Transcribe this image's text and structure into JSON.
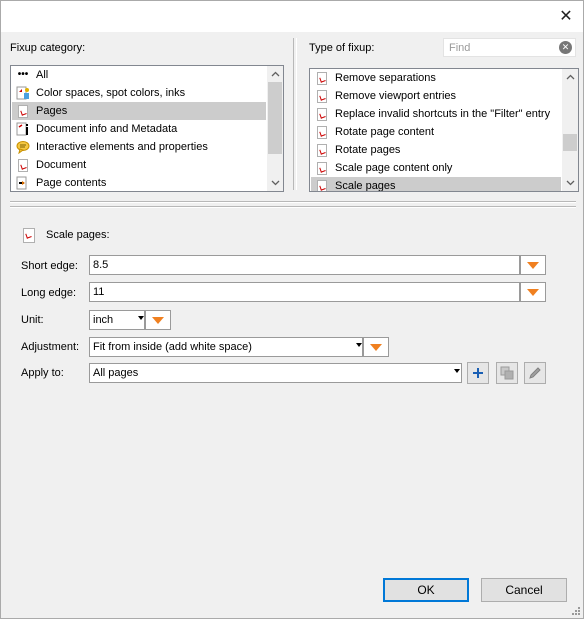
{
  "window": {
    "close_glyph": "✕"
  },
  "fixup_category": {
    "label": "Fixup category:",
    "items": [
      {
        "label": "All",
        "icon": "ellipsis-icon",
        "selected": false
      },
      {
        "label": "Color spaces, spot colors, inks",
        "icon": "color-spaces-icon",
        "selected": false
      },
      {
        "label": "Pages",
        "icon": "pdf-page-icon",
        "selected": true
      },
      {
        "label": "Document info and Metadata",
        "icon": "document-info-icon",
        "selected": false
      },
      {
        "label": "Interactive elements and properties",
        "icon": "comment-icon",
        "selected": false
      },
      {
        "label": "Document",
        "icon": "pdf-document-icon",
        "selected": false
      },
      {
        "label": "Page contents",
        "icon": "page-contents-icon",
        "selected": false
      }
    ]
  },
  "type_of_fixup": {
    "label": "Type of fixup:",
    "find_placeholder": "Find",
    "find_value": "",
    "items": [
      {
        "label": "Remove separations",
        "selected": false
      },
      {
        "label": "Remove viewport entries",
        "selected": false
      },
      {
        "label": "Replace invalid shortcuts in the \"Filter\" entry",
        "selected": false
      },
      {
        "label": "Rotate page content",
        "selected": false
      },
      {
        "label": "Rotate pages",
        "selected": false
      },
      {
        "label": "Scale page content only",
        "selected": false
      },
      {
        "label": "Scale pages",
        "selected": true
      }
    ]
  },
  "details": {
    "title": "Scale pages:",
    "short_edge": {
      "label": "Short edge:",
      "value": "8.5"
    },
    "long_edge": {
      "label": "Long edge:",
      "value": "11"
    },
    "unit": {
      "label": "Unit:",
      "value": "inch"
    },
    "adjustment": {
      "label": "Adjustment:",
      "value": "Fit from inside (add white space)"
    },
    "apply_to": {
      "label": "Apply to:",
      "value": "All pages"
    }
  },
  "buttons": {
    "ok": "OK",
    "cancel": "Cancel"
  },
  "colors": {
    "accent_orange": "#f08020",
    "pdf_red": "#cc0000",
    "selection": "#cccccc",
    "default_button_border": "#0078d7"
  }
}
